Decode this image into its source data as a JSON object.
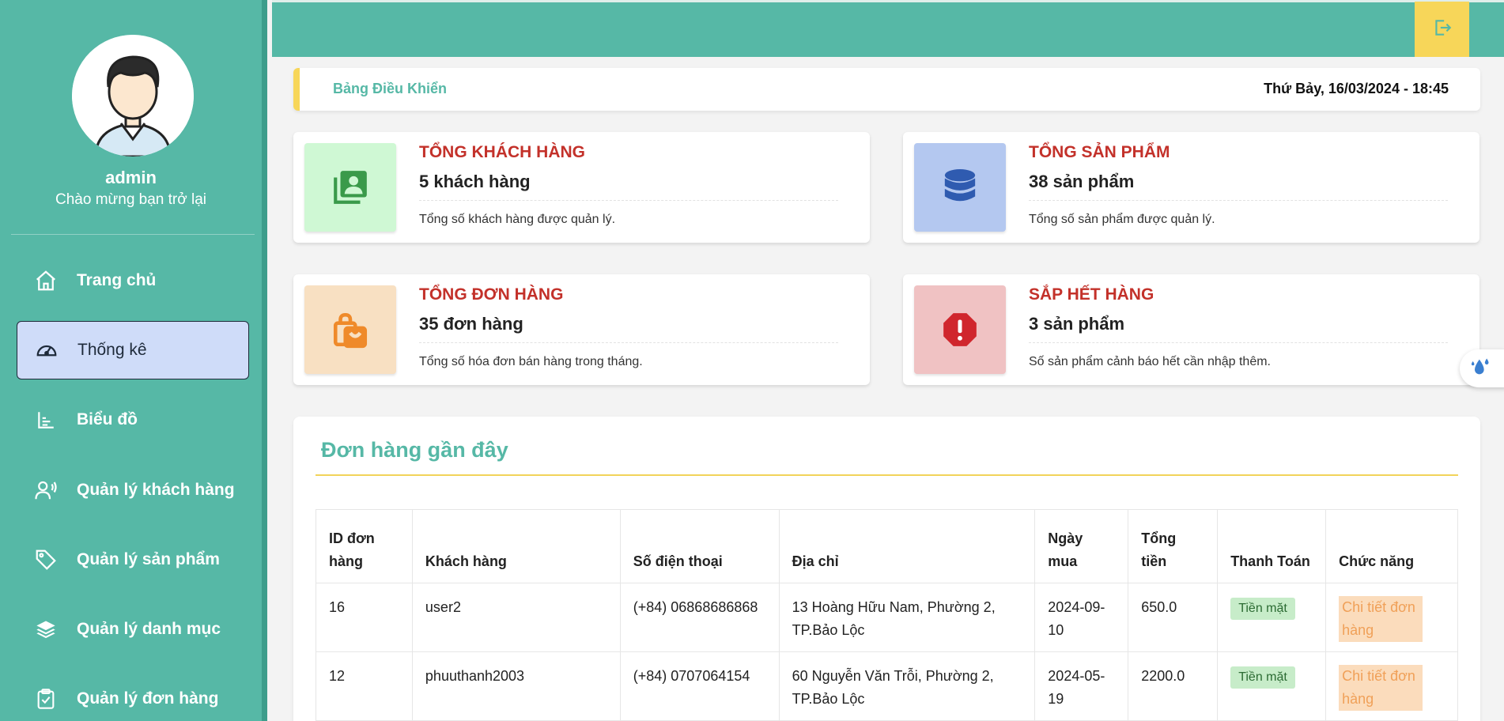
{
  "sidebar": {
    "user_name": "admin",
    "greeting": "Chào mừng bạn trở lại",
    "items": [
      {
        "label": "Trang chủ",
        "icon": "home-icon"
      },
      {
        "label": "Thống kê",
        "icon": "dashboard-gauge-icon",
        "active": true
      },
      {
        "label": "Biểu đồ",
        "icon": "bar-chart-icon"
      },
      {
        "label": "Quản lý khách hàng",
        "icon": "user-voice-icon"
      },
      {
        "label": "Quản lý sản phẩm",
        "icon": "tag-icon"
      },
      {
        "label": "Quản lý danh mục",
        "icon": "layers-icon"
      },
      {
        "label": "Quản lý đơn hàng",
        "icon": "clipboard-check-icon"
      }
    ]
  },
  "header": {
    "breadcrumb": "Bảng Điều Khiển",
    "datetime": "Thứ Bảy, 16/03/2024 - 18:45",
    "logout_icon": "logout-icon"
  },
  "cards": [
    {
      "title": "TỔNG KHÁCH HÀNG",
      "value": "5 khách hàng",
      "desc": "Tổng số khách hàng được quản lý.",
      "icon": "contacts-icon",
      "bg": "#cff8d4",
      "fg": "#3a9a4a"
    },
    {
      "title": "TỔNG SẢN PHẨM",
      "value": "38 sản phẩm",
      "desc": "Tổng số sản phẩm được quản lý.",
      "icon": "database-icon",
      "bg": "#b4c8f0",
      "fg": "#2f5bb0"
    },
    {
      "title": "TỔNG ĐƠN HÀNG",
      "value": "35 đơn hàng",
      "desc": "Tổng số hóa đơn bán hàng trong tháng.",
      "icon": "shopping-bag-icon",
      "bg": "#f8e0c2",
      "fg": "#ef8a2a"
    },
    {
      "title": "SẮP HẾT HÀNG",
      "value": "3 sản phẩm",
      "desc": "Số sản phẩm cảnh báo hết cần nhập thêm.",
      "icon": "warning-octagon-icon",
      "bg": "#f0c2c3",
      "fg": "#d0262d"
    }
  ],
  "orders": {
    "title": "Đơn hàng gần đây",
    "columns": [
      "ID đơn hàng",
      "Khách hàng",
      "Số điện thoại",
      "Địa chỉ",
      "Ngày mua",
      "Tổng tiền",
      "Thanh Toán",
      "Chức năng"
    ],
    "rows": [
      {
        "id": "16",
        "customer": "user2",
        "phone": "(+84) 06868686868",
        "address": "13 Hoàng Hữu Nam, Phường 2, TP.Bảo Lộc",
        "date": "2024-09-10",
        "total": "650.0",
        "payment": "Tiền mặt",
        "action": "Chi tiết đơn hàng"
      },
      {
        "id": "12",
        "customer": "phuuthanh2003",
        "phone": "(+84) 0707064154",
        "address": "60 Nguyễn Văn Trỗi, Phường 2, TP.Bảo Lộc",
        "date": "2024-05-19",
        "total": "2200.0",
        "payment": "Tiền mặt",
        "action": "Chi tiết đơn hàng"
      }
    ]
  },
  "colors": {
    "primary": "#56b8a6",
    "accent": "#f7d659",
    "danger_title": "#c3312a"
  }
}
